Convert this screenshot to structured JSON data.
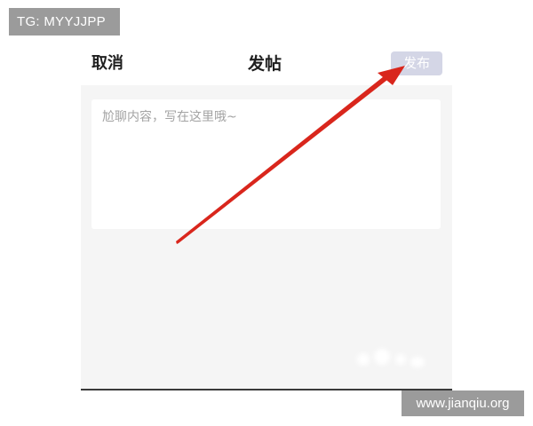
{
  "watermarks": {
    "telegram": "TG: MYYJJPP",
    "site": "www.jianqiu.org"
  },
  "nav": {
    "cancel_label": "取消",
    "title": "发帖",
    "publish_label": "发布"
  },
  "editor": {
    "placeholder": "尬聊内容，写在这里哦~"
  },
  "colors": {
    "publish_button_bg": "#d4d6e6",
    "panel_bg": "#f5f5f5",
    "annotation_arrow": "#d9261c"
  }
}
